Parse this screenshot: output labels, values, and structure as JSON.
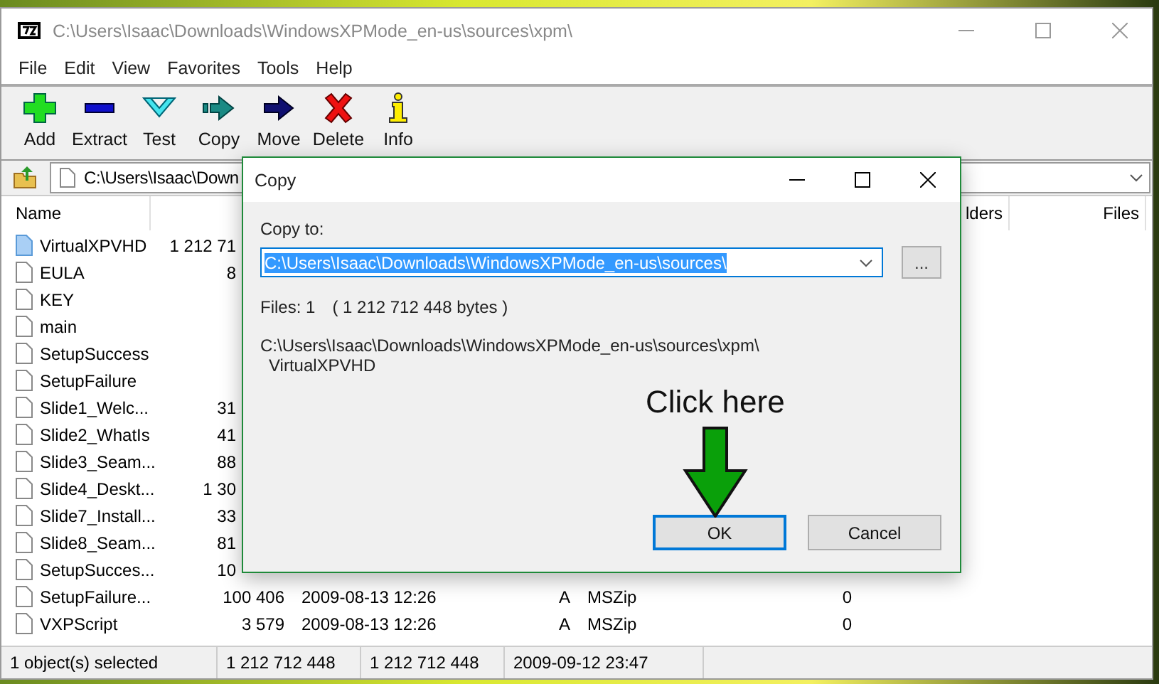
{
  "window": {
    "title": "C:\\Users\\Isaac\\Downloads\\WindowsXPMode_en-us\\sources\\xpm\\"
  },
  "menu": [
    "File",
    "Edit",
    "View",
    "Favorites",
    "Tools",
    "Help"
  ],
  "toolbar": [
    {
      "label": "Add",
      "kind": "add"
    },
    {
      "label": "Extract",
      "kind": "extract"
    },
    {
      "label": "Test",
      "kind": "test"
    },
    {
      "label": "Copy",
      "kind": "copy"
    },
    {
      "label": "Move",
      "kind": "move"
    },
    {
      "label": "Delete",
      "kind": "delete"
    },
    {
      "label": "Info",
      "kind": "info"
    }
  ],
  "address": {
    "value": "C:\\Users\\Isaac\\Down"
  },
  "columns": [
    {
      "label": "Name"
    },
    {
      "label": "lders"
    },
    {
      "label": "Files"
    }
  ],
  "rows": [
    {
      "name": "VirtualXPVHD",
      "selected": true,
      "kind": "partial",
      "size": "1 212 71"
    },
    {
      "name": "EULA",
      "selected": false,
      "kind": "partial",
      "size": "8"
    },
    {
      "name": "KEY",
      "selected": false,
      "kind": "partial"
    },
    {
      "name": "main",
      "selected": false,
      "kind": "partial"
    },
    {
      "name": "SetupSuccess",
      "selected": false,
      "kind": "partial"
    },
    {
      "name": "SetupFailure",
      "selected": false,
      "kind": "partial"
    },
    {
      "name": "Slide1_Welc...",
      "selected": false,
      "kind": "partial",
      "size": "31"
    },
    {
      "name": "Slide2_WhatIs",
      "selected": false,
      "kind": "partial",
      "size": "41"
    },
    {
      "name": "Slide3_Seam...",
      "selected": false,
      "kind": "partial",
      "size": "88"
    },
    {
      "name": "Slide4_Deskt...",
      "selected": false,
      "kind": "partial",
      "size": "1 30"
    },
    {
      "name": "Slide7_Install...",
      "selected": false,
      "kind": "partial",
      "size": "33"
    },
    {
      "name": "Slide8_Seam...",
      "selected": false,
      "kind": "partial",
      "size": "81"
    },
    {
      "name": "SetupSucces...",
      "selected": false,
      "kind": "partial",
      "size": "10"
    },
    {
      "name": "SetupFailure...",
      "selected": false,
      "kind": "full",
      "size": "100 406",
      "modified": "2009-08-13 12:26",
      "attributes": "A",
      "method": "MSZip",
      "column_6": "0"
    },
    {
      "name": "VXPScript",
      "selected": false,
      "kind": "full",
      "size": "3 579",
      "modified": "2009-08-13 12:26",
      "attributes": "A",
      "method": "MSZip",
      "column_6": "0"
    }
  ],
  "status_bar": [
    "1 object(s) selected",
    "1 212 712 448",
    "1 212 712 448",
    "2009-09-12 23:47"
  ],
  "dialog": {
    "title": "Copy",
    "label": "Copy to:",
    "destination": "C:\\Users\\Isaac\\Downloads\\WindowsXPMode_en-us\\sources\\",
    "browse": "...",
    "files": "Files: 1",
    "bytes": "( 1 212 712 448 bytes )",
    "source_path": "C:\\Users\\Isaac\\Downloads\\WindowsXPMode_en-us\\sources\\xpm\\",
    "source_item": "VirtualXPVHD",
    "buttons": [
      {
        "label": "OK",
        "focused": true
      },
      {
        "label": "Cancel",
        "focused": false
      }
    ]
  },
  "annotation": {
    "text": "Click here"
  }
}
